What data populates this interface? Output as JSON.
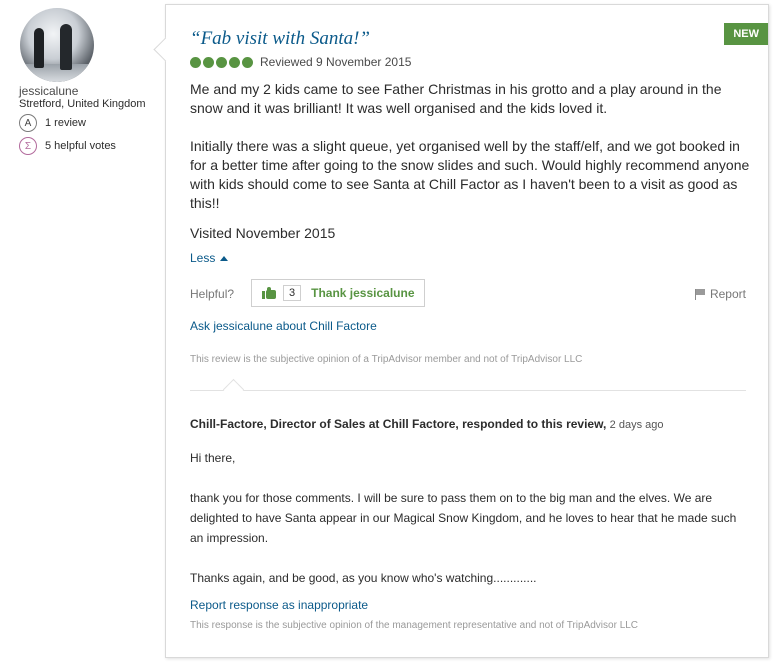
{
  "reviewer": {
    "username": "jessicalune",
    "location": "Stretford, United Kingdom",
    "reviews": "1 review",
    "helpful_votes": "5 helpful votes",
    "review_badge_glyph": "A",
    "votes_badge_glyph": "Ʃ"
  },
  "review": {
    "badge": "NEW",
    "title": "“Fab visit with Santa!”",
    "rating": 5,
    "reviewed_date": "Reviewed 9 November 2015",
    "paragraph1": "Me and my 2 kids came to see Father Christmas in his grotto and a play around in the snow and it was brilliant! It was well organised and the kids loved it.",
    "paragraph2": "Initially there was a slight queue, yet organised well by the staff/elf, and we got booked in for a better time after going to the snow slides and such. Would highly recommend anyone with kids should come to see Santa at Chill Factor as I haven't been to a visit as good as this!!",
    "visited": "Visited November 2015",
    "less_label": "Less",
    "helpful_label": "Helpful?",
    "thank_count": "3",
    "thank_label": "Thank jessicalune",
    "report_label": "Report",
    "ask_link": "Ask jessicalune about Chill Factore",
    "disclaimer": "This review is the subjective opinion of a TripAdvisor member and not of TripAdvisor LLC"
  },
  "response": {
    "responder": "Chill-Factore, Director of Sales at Chill Factore, responded to this review,",
    "ago": "2 days ago",
    "greeting": "Hi there,",
    "paragraph1": "thank you for those comments. I will be sure to pass them on to the big man and the elves. We are delighted to have Santa appear in our Magical Snow Kingdom, and he loves to hear that he made such an impression.",
    "paragraph2": "Thanks again, and be good, as you know who's watching.............",
    "report_link": "Report response as inappropriate",
    "disclaimer": "This response is the subjective opinion of the management representative and not of TripAdvisor LLC"
  },
  "colors": {
    "accent_green": "#589442",
    "link_blue": "#0b5a8a"
  },
  "icons": [
    "avatar-photo",
    "review-count-icon",
    "helpful-votes-icon",
    "rating-bubble",
    "thumbs-up-icon",
    "flag-icon",
    "caret-up-icon"
  ]
}
